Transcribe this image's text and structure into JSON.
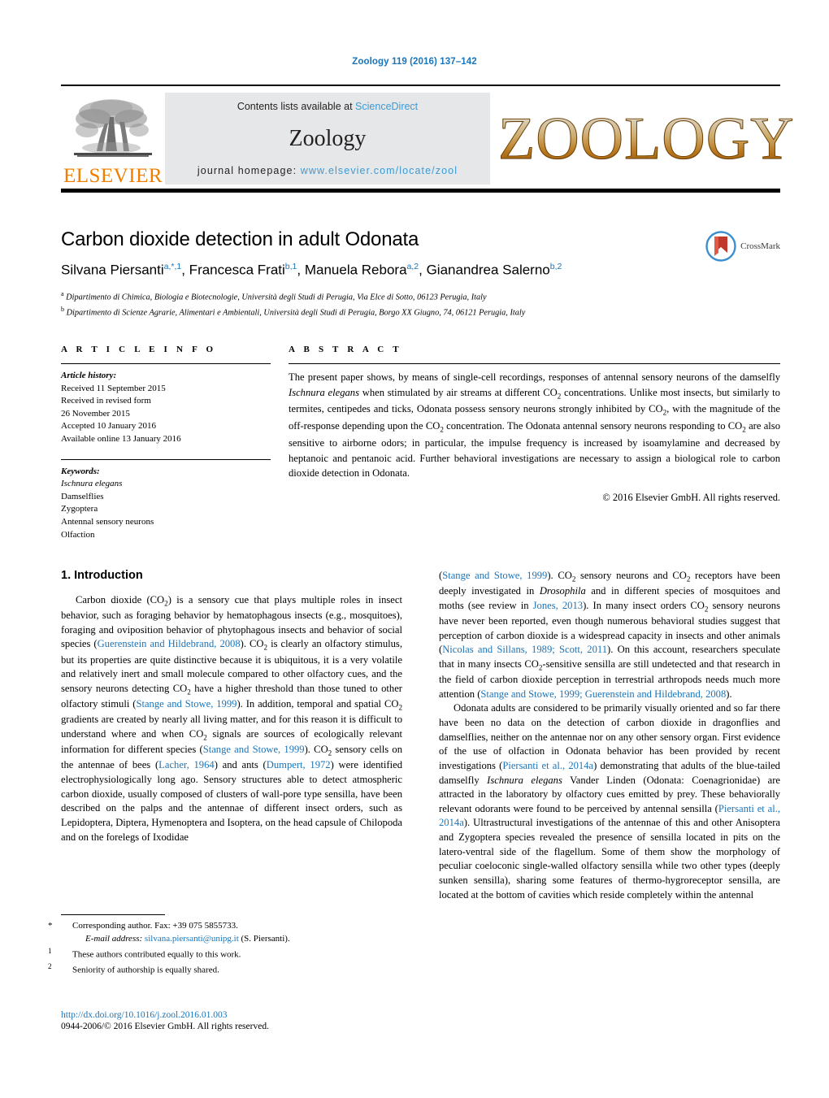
{
  "running_head": "Zoology 119 (2016) 137–142",
  "masthead": {
    "publisher_name": "ELSEVIER",
    "contents_prefix": "Contents lists available at",
    "contents_link": "ScienceDirect",
    "journal_name": "Zoology",
    "homepage_prefix": "journal homepage:",
    "homepage_url": "www.elsevier.com/locate/zool",
    "journal_logo_text": "ZOOLOGY"
  },
  "crossmark": {
    "label": "CrossMark"
  },
  "title": "Carbon dioxide detection in adult Odonata",
  "authors_html": "Silvana Piersanti<sup>a,*,1</sup>, Francesca Frati<sup>b,1</sup>, Manuela Rebora<sup>a,2</sup>, Giandrea Salerno<sup>b,2</sup>",
  "authors_plain": "Silvana Piersanti a,*,1, Francesca Frati b,1, Manuela Rebora a,2, Gianandrea Salerno b,2",
  "affiliations": [
    {
      "mark": "a",
      "text": "Dipartimento di Chimica, Biologia e Biotecnologie, Università degli Studi di Perugia, Via Elce di Sotto, 06123 Perugia, Italy"
    },
    {
      "mark": "b",
      "text": "Dipartimento di Scienze Agrarie, Alimentari e Ambientali, Università degli Studi di Perugia, Borgo XX Giugno, 74, 06121 Perugia, Italy"
    }
  ],
  "article_info": {
    "heading": "A R T I C L E   I N F O",
    "history_label": "Article history:",
    "history": [
      "Received 11 September 2015",
      "Received in revised form",
      "26 November 2015",
      "Accepted 10 January 2016",
      "Available online 13 January 2016"
    ],
    "keywords_label": "Keywords:",
    "keywords": [
      "Ischnura elegans",
      "Damselflies",
      "Zygoptera",
      "Antennal sensory neurons",
      "Olfaction"
    ]
  },
  "abstract": {
    "heading": "A B S T R A C T",
    "copyright": "© 2016 Elsevier GmbH. All rights reserved."
  },
  "introduction": {
    "heading": "1. Introduction"
  },
  "footnotes": {
    "corresponding": "Corresponding author. Fax: +39 075 5855733.",
    "email_label": "E-mail address:",
    "email": "silvana.piersanti@unipg.it",
    "email_owner": "(S. Piersanti).",
    "note1": "These authors contributed equally to this work.",
    "note2": "Seniority of authorship is equally shared."
  },
  "doi": {
    "url": "http://dx.doi.org/10.1016/j.zool.2016.01.003",
    "issn_line": "0944-2006/© 2016 Elsevier GmbH. All rights reserved."
  },
  "colors": {
    "link_blue": "#1a75bb",
    "sciencedirect_blue": "#3d9ad3",
    "elsevier_orange": "#f07d00",
    "band_grey": "#e6e7e8"
  }
}
